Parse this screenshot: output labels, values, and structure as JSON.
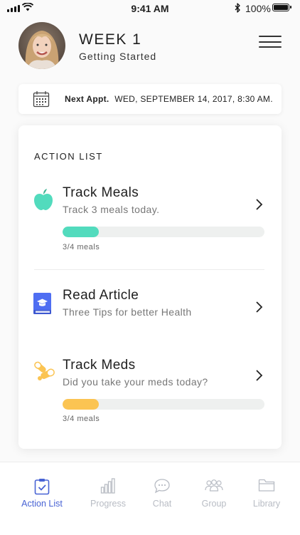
{
  "status_bar": {
    "time": "9:41 AM",
    "battery": "100%",
    "icons": [
      "signal-icon",
      "wifi-icon",
      "bluetooth-icon",
      "battery-icon"
    ]
  },
  "header": {
    "title": "WEEK 1",
    "subtitle": "Getting Started",
    "icons": [
      "avatar",
      "hamburger-menu-icon"
    ]
  },
  "appointment": {
    "label": "Next Appt.",
    "value": "WED, SEPTEMBER 14, 2017, 8:30 AM.",
    "icon": "calendar-icon"
  },
  "action_list": {
    "heading": "ACTION LIST",
    "items": [
      {
        "title": "Track Meals",
        "subtitle": "Track 3 meals today.",
        "icon": "apple-icon",
        "progress_label": "3/4 meals",
        "progress_fraction": 0.18,
        "color": "#52dbbd"
      },
      {
        "title": "Read Article",
        "subtitle": "Three Tips for better Health",
        "icon": "book-icon",
        "color": "#4f6ef2"
      },
      {
        "title": "Track Meds",
        "subtitle": "Did you take your meds today?",
        "icon": "pills-icon",
        "progress_label": "3/4 meals",
        "progress_fraction": 0.18,
        "color": "#fbc452"
      }
    ]
  },
  "tabs": [
    {
      "label": "Action List",
      "icon": "clipboard-check-icon",
      "active": true
    },
    {
      "label": "Progress",
      "icon": "bar-chart-icon",
      "active": false
    },
    {
      "label": "Chat",
      "icon": "chat-bubble-icon",
      "active": false
    },
    {
      "label": "Group",
      "icon": "group-icon",
      "active": false
    },
    {
      "label": "Library",
      "icon": "folder-icon",
      "active": false
    }
  ],
  "colors": {
    "accent": "#4863d4",
    "inactive_tab": "#b8bcc4",
    "meals_progress": "#52dbbd",
    "meds_progress": "#fbc452"
  }
}
